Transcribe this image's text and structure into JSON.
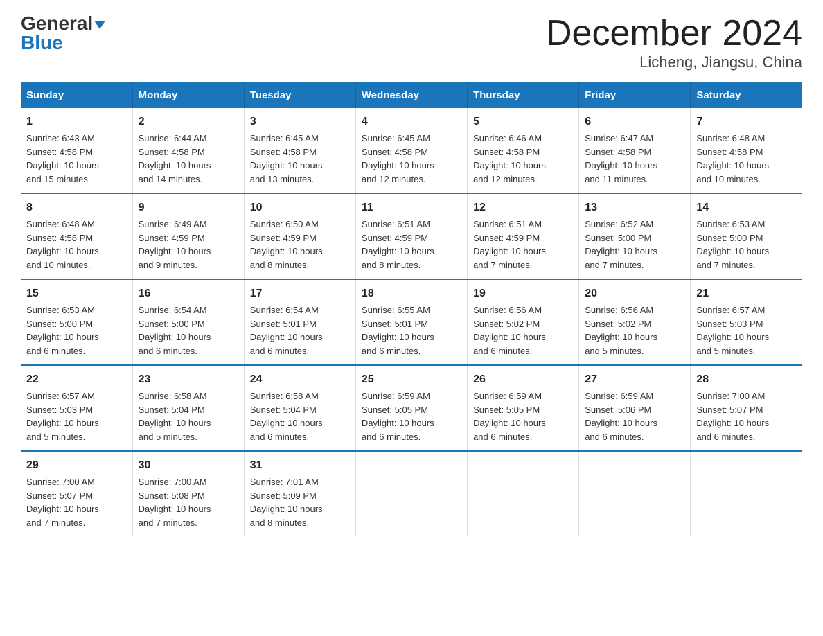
{
  "logo": {
    "part1": "General",
    "part2": "Blue"
  },
  "title": "December 2024",
  "location": "Licheng, Jiangsu, China",
  "days_of_week": [
    "Sunday",
    "Monday",
    "Tuesday",
    "Wednesday",
    "Thursday",
    "Friday",
    "Saturday"
  ],
  "weeks": [
    [
      {
        "day": "1",
        "info": "Sunrise: 6:43 AM\nSunset: 4:58 PM\nDaylight: 10 hours\nand 15 minutes."
      },
      {
        "day": "2",
        "info": "Sunrise: 6:44 AM\nSunset: 4:58 PM\nDaylight: 10 hours\nand 14 minutes."
      },
      {
        "day": "3",
        "info": "Sunrise: 6:45 AM\nSunset: 4:58 PM\nDaylight: 10 hours\nand 13 minutes."
      },
      {
        "day": "4",
        "info": "Sunrise: 6:45 AM\nSunset: 4:58 PM\nDaylight: 10 hours\nand 12 minutes."
      },
      {
        "day": "5",
        "info": "Sunrise: 6:46 AM\nSunset: 4:58 PM\nDaylight: 10 hours\nand 12 minutes."
      },
      {
        "day": "6",
        "info": "Sunrise: 6:47 AM\nSunset: 4:58 PM\nDaylight: 10 hours\nand 11 minutes."
      },
      {
        "day": "7",
        "info": "Sunrise: 6:48 AM\nSunset: 4:58 PM\nDaylight: 10 hours\nand 10 minutes."
      }
    ],
    [
      {
        "day": "8",
        "info": "Sunrise: 6:48 AM\nSunset: 4:58 PM\nDaylight: 10 hours\nand 10 minutes."
      },
      {
        "day": "9",
        "info": "Sunrise: 6:49 AM\nSunset: 4:59 PM\nDaylight: 10 hours\nand 9 minutes."
      },
      {
        "day": "10",
        "info": "Sunrise: 6:50 AM\nSunset: 4:59 PM\nDaylight: 10 hours\nand 8 minutes."
      },
      {
        "day": "11",
        "info": "Sunrise: 6:51 AM\nSunset: 4:59 PM\nDaylight: 10 hours\nand 8 minutes."
      },
      {
        "day": "12",
        "info": "Sunrise: 6:51 AM\nSunset: 4:59 PM\nDaylight: 10 hours\nand 7 minutes."
      },
      {
        "day": "13",
        "info": "Sunrise: 6:52 AM\nSunset: 5:00 PM\nDaylight: 10 hours\nand 7 minutes."
      },
      {
        "day": "14",
        "info": "Sunrise: 6:53 AM\nSunset: 5:00 PM\nDaylight: 10 hours\nand 7 minutes."
      }
    ],
    [
      {
        "day": "15",
        "info": "Sunrise: 6:53 AM\nSunset: 5:00 PM\nDaylight: 10 hours\nand 6 minutes."
      },
      {
        "day": "16",
        "info": "Sunrise: 6:54 AM\nSunset: 5:00 PM\nDaylight: 10 hours\nand 6 minutes."
      },
      {
        "day": "17",
        "info": "Sunrise: 6:54 AM\nSunset: 5:01 PM\nDaylight: 10 hours\nand 6 minutes."
      },
      {
        "day": "18",
        "info": "Sunrise: 6:55 AM\nSunset: 5:01 PM\nDaylight: 10 hours\nand 6 minutes."
      },
      {
        "day": "19",
        "info": "Sunrise: 6:56 AM\nSunset: 5:02 PM\nDaylight: 10 hours\nand 6 minutes."
      },
      {
        "day": "20",
        "info": "Sunrise: 6:56 AM\nSunset: 5:02 PM\nDaylight: 10 hours\nand 5 minutes."
      },
      {
        "day": "21",
        "info": "Sunrise: 6:57 AM\nSunset: 5:03 PM\nDaylight: 10 hours\nand 5 minutes."
      }
    ],
    [
      {
        "day": "22",
        "info": "Sunrise: 6:57 AM\nSunset: 5:03 PM\nDaylight: 10 hours\nand 5 minutes."
      },
      {
        "day": "23",
        "info": "Sunrise: 6:58 AM\nSunset: 5:04 PM\nDaylight: 10 hours\nand 5 minutes."
      },
      {
        "day": "24",
        "info": "Sunrise: 6:58 AM\nSunset: 5:04 PM\nDaylight: 10 hours\nand 6 minutes."
      },
      {
        "day": "25",
        "info": "Sunrise: 6:59 AM\nSunset: 5:05 PM\nDaylight: 10 hours\nand 6 minutes."
      },
      {
        "day": "26",
        "info": "Sunrise: 6:59 AM\nSunset: 5:05 PM\nDaylight: 10 hours\nand 6 minutes."
      },
      {
        "day": "27",
        "info": "Sunrise: 6:59 AM\nSunset: 5:06 PM\nDaylight: 10 hours\nand 6 minutes."
      },
      {
        "day": "28",
        "info": "Sunrise: 7:00 AM\nSunset: 5:07 PM\nDaylight: 10 hours\nand 6 minutes."
      }
    ],
    [
      {
        "day": "29",
        "info": "Sunrise: 7:00 AM\nSunset: 5:07 PM\nDaylight: 10 hours\nand 7 minutes."
      },
      {
        "day": "30",
        "info": "Sunrise: 7:00 AM\nSunset: 5:08 PM\nDaylight: 10 hours\nand 7 minutes."
      },
      {
        "day": "31",
        "info": "Sunrise: 7:01 AM\nSunset: 5:09 PM\nDaylight: 10 hours\nand 8 minutes."
      },
      {
        "day": "",
        "info": ""
      },
      {
        "day": "",
        "info": ""
      },
      {
        "day": "",
        "info": ""
      },
      {
        "day": "",
        "info": ""
      }
    ]
  ]
}
